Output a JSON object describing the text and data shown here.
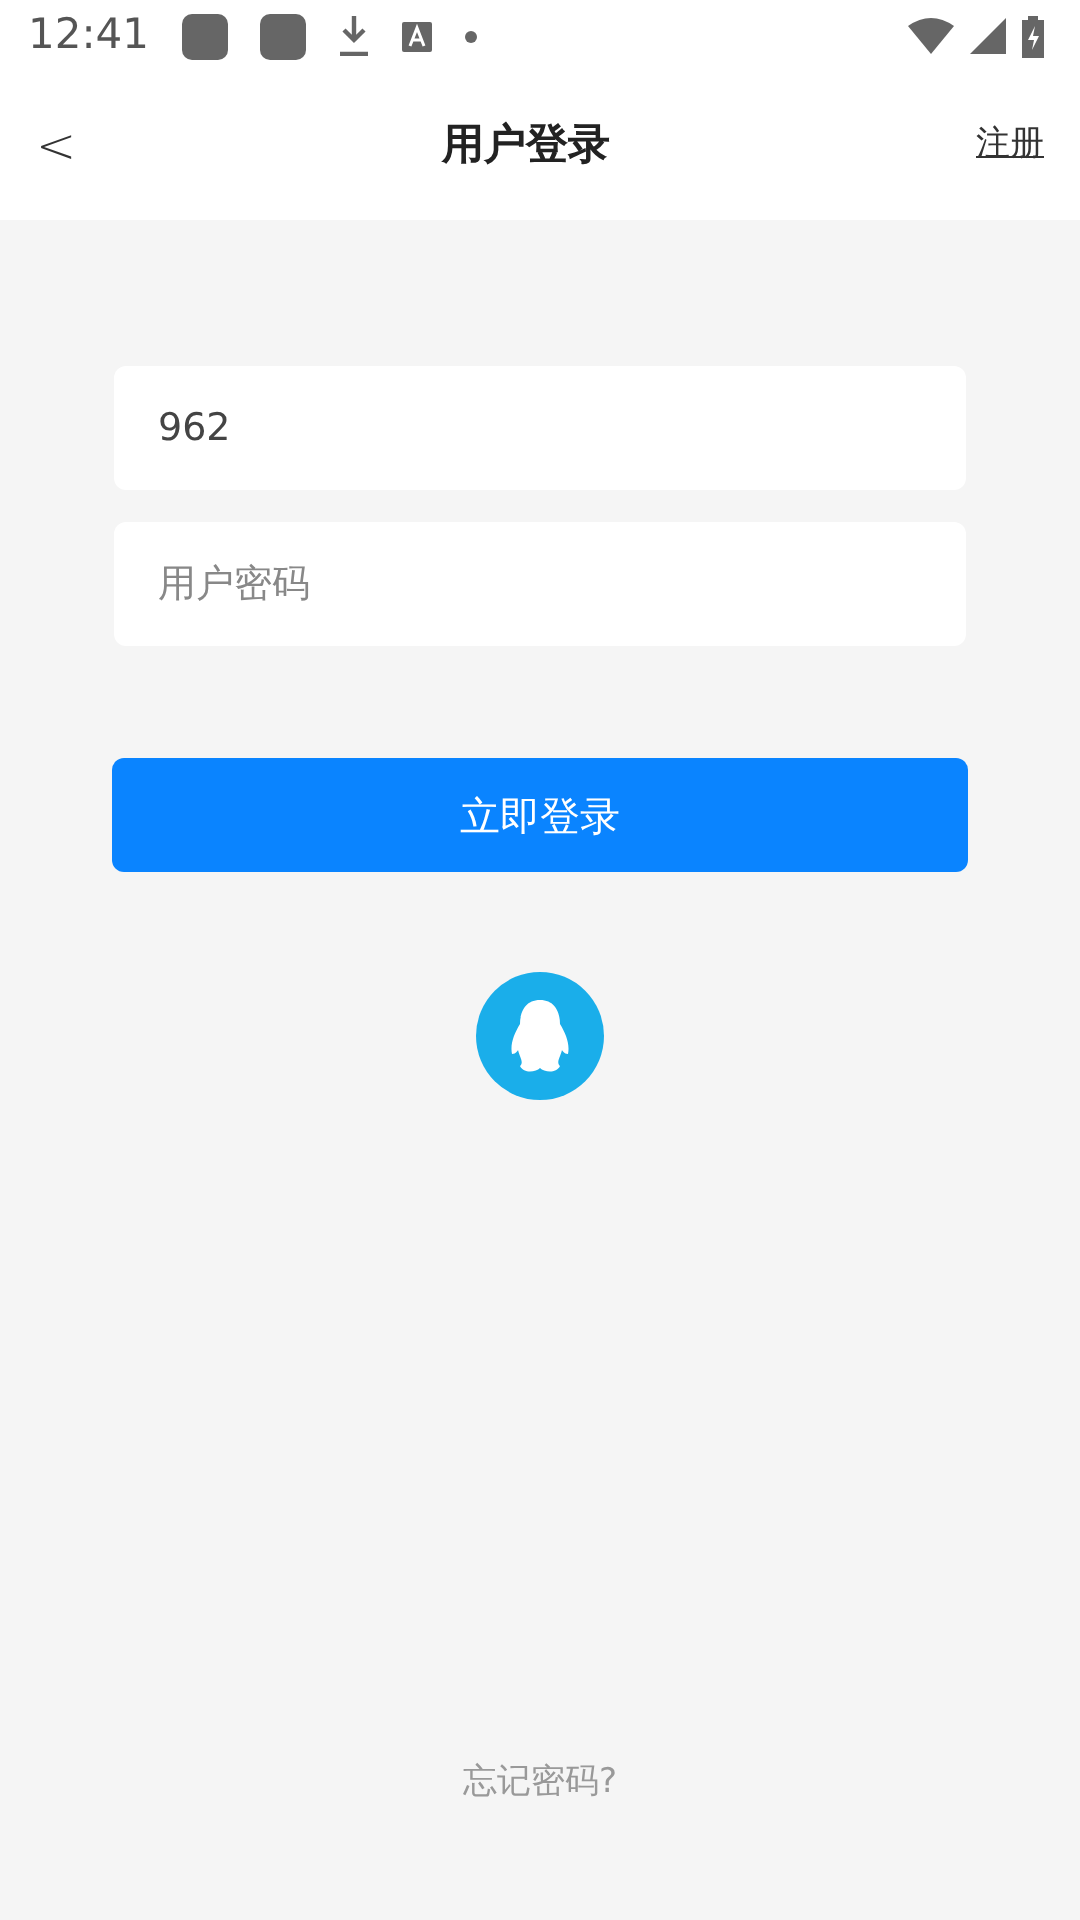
{
  "status_bar": {
    "time": "12:41"
  },
  "header": {
    "back": "<",
    "title": "用户登录",
    "action": "注册"
  },
  "form": {
    "username": {
      "value": "962"
    },
    "password": {
      "placeholder": "用户密码"
    },
    "submit": "立即登录"
  },
  "forgot_link": "忘记密码?"
}
